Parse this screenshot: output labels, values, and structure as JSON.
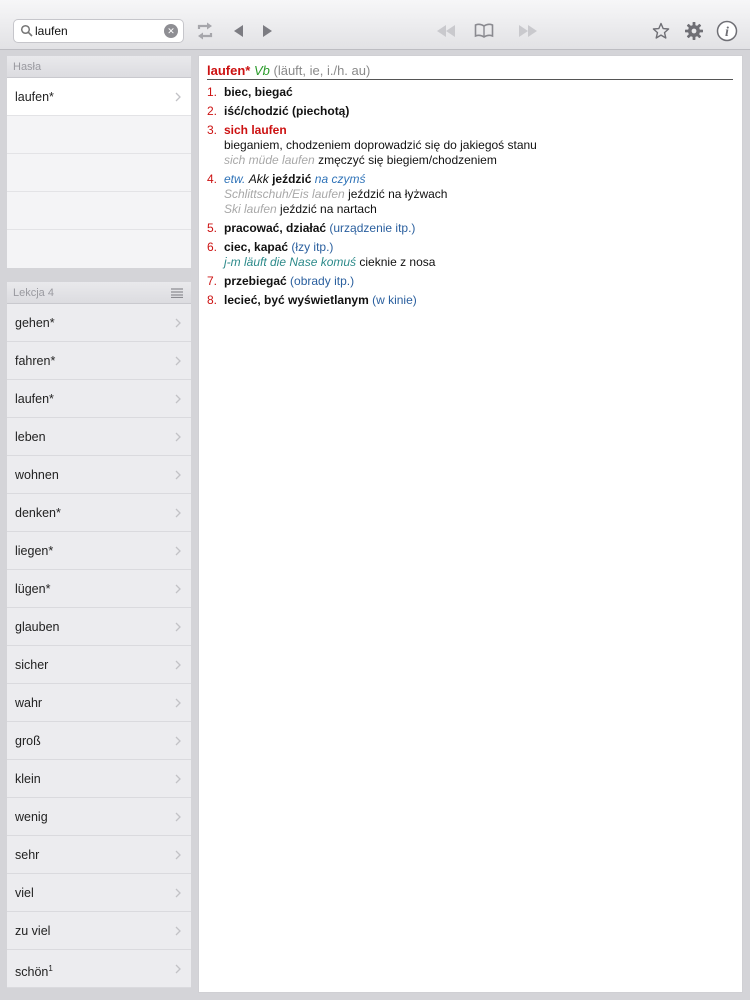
{
  "toolbar": {
    "search_value": "laufen",
    "icons": [
      "search-icon",
      "clear-icon",
      "refresh-icon",
      "back-arrow-icon",
      "forward-arrow-icon",
      "rewind-icon",
      "book-icon",
      "fast-forward-icon",
      "star-icon",
      "gear-icon",
      "info-icon"
    ]
  },
  "sidebar": {
    "entries_header": "Hasła",
    "entries": [
      "laufen*",
      "",
      "",
      "",
      ""
    ],
    "lesson_header": "Lekcja 4",
    "lesson_items": [
      "gehen*",
      "fahren*",
      "laufen*",
      "leben",
      "wohnen",
      "denken*",
      "liegen*",
      "lügen*",
      "glauben",
      "sicher",
      "wahr",
      "groß",
      "klein",
      "wenig",
      "sehr",
      "viel",
      "zu viel",
      "schön"
    ],
    "last_item_sup": "1"
  },
  "entry": {
    "headword": "laufen*",
    "pos": "Vb",
    "forms": "(läuft, ie, i./h. au)",
    "senses": [
      {
        "num": "1.",
        "text": "biec, biegać"
      },
      {
        "num": "2.",
        "text": "iść/chodzić (piechotą)"
      },
      {
        "num": "3.",
        "phrase": "sich laufen",
        "desc": "bieganiem, chodzeniem doprowadzić się do jakiegoś stanu",
        "ex_de": "sich müde laufen",
        "ex_pl": "zmęczyć się biegiem/chodzeniem"
      },
      {
        "num": "4.",
        "pre_it": "etw.",
        "pre_case": "Akk",
        "text": "jeździć",
        "note": "na czymś",
        "ex1_de": "Schlittschuh/Eis laufen",
        "ex1_pl": "jeździć na łyżwach",
        "ex2_de": "Ski laufen",
        "ex2_pl": "jeździć na nartach"
      },
      {
        "num": "5.",
        "text": "pracować, działać",
        "note": "(urządzenie itp.)"
      },
      {
        "num": "6.",
        "text": "ciec, kapać",
        "note": "(łzy itp.)",
        "ex_de": "j-m läuft die Nase komuś",
        "ex_pl": "cieknie z nosa"
      },
      {
        "num": "7.",
        "text": "przebiegać",
        "note": "(obrady itp.)"
      },
      {
        "num": "8.",
        "text": "lecieć, być wyświetlanym",
        "note": "(w kinie)"
      }
    ]
  },
  "colors": {
    "headword": "#cc1111",
    "pos": "#2a9b2a",
    "note_blue": "#2a5f9e",
    "example_grey": "#a8a8a8",
    "example_teal": "#2c8a8a"
  }
}
